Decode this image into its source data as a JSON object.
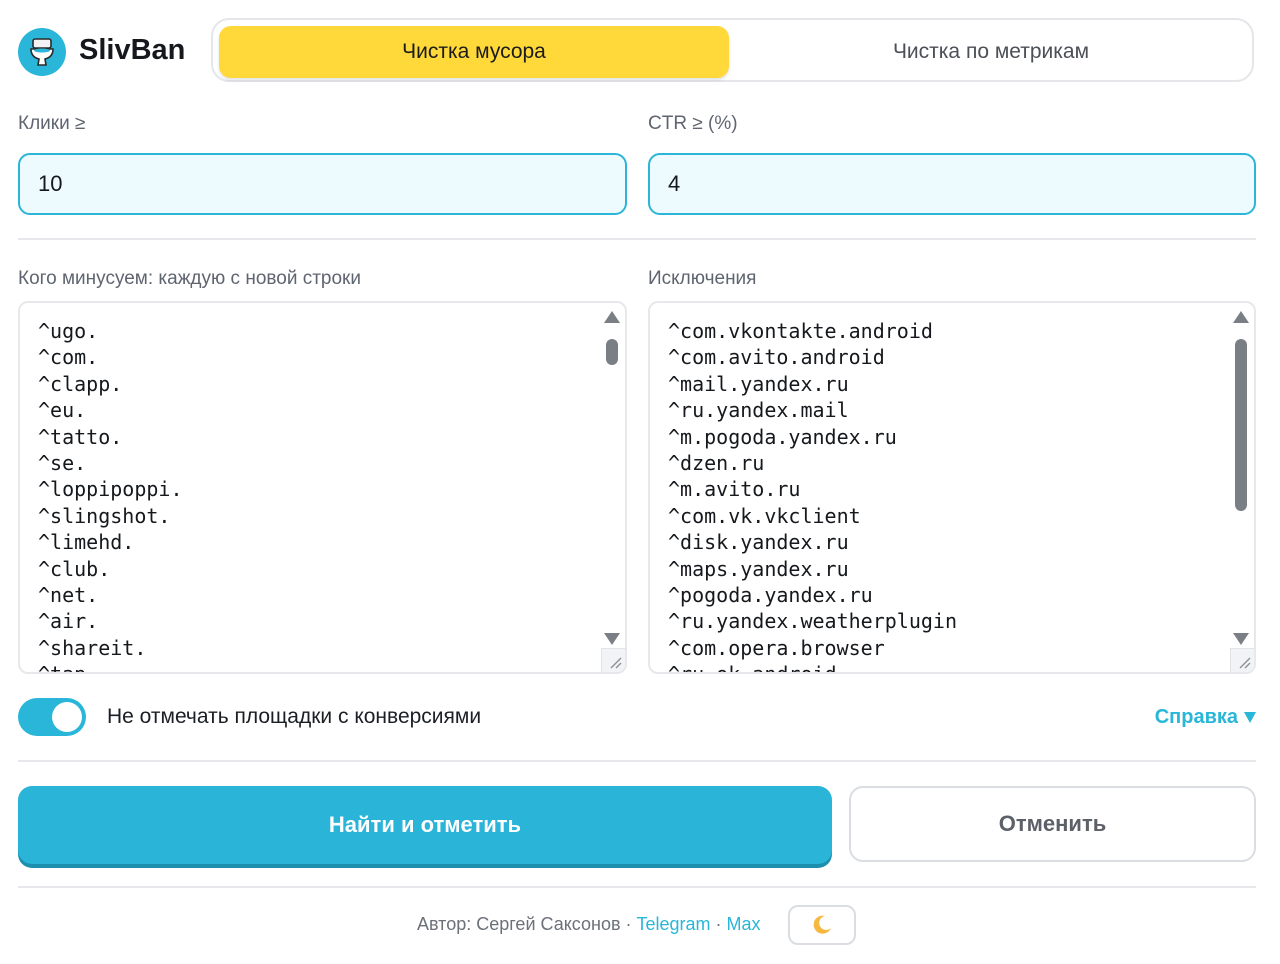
{
  "header": {
    "brand": "SlivBan",
    "logo_icon": "toilet-icon"
  },
  "tabs": [
    {
      "label": "Чистка мусора",
      "active": true
    },
    {
      "label": "Чистка по метрикам",
      "active": false
    }
  ],
  "filters": {
    "clicks": {
      "label": "Клики ≥",
      "value": "10"
    },
    "ctr": {
      "label": "CTR ≥ (%)",
      "value": "4"
    }
  },
  "minus_list": {
    "label": "Кого минусуем: каждую с новой строки",
    "lines": [
      "^ugo.",
      "^com.",
      "^clapp.",
      "^eu.",
      "^tatto.",
      "^se.",
      "^loppipoppi.",
      "^slingshot.",
      "^limehd.",
      "^club.",
      "^net.",
      "^air.",
      "^shareit.",
      "^tap."
    ]
  },
  "exceptions": {
    "label": "Исключения",
    "lines": [
      "^com.vkontakte.android",
      "^com.avito.android",
      "^mail.yandex.ru",
      "^ru.yandex.mail",
      "^m.pogoda.yandex.ru",
      "^dzen.ru",
      "^m.avito.ru",
      "^com.vk.vkclient",
      "^disk.yandex.ru",
      "^maps.yandex.ru",
      "^pogoda.yandex.ru",
      "^ru.yandex.weatherplugin",
      "^com.opera.browser",
      "^ru.ok.android"
    ]
  },
  "toggle": {
    "label": "Не отмечать площадки с конверсиями",
    "on": true
  },
  "help": {
    "label": "Справка"
  },
  "actions": {
    "primary": "Найти и отметить",
    "secondary": "Отменить"
  },
  "footer": {
    "author": "Автор: Сергей Саксонов",
    "sep": "·",
    "telegram": "Telegram",
    "max": "Max",
    "theme_icon": "moon-icon"
  },
  "colors": {
    "accent": "#29b6d8",
    "tab_active": "#ffd83a"
  }
}
